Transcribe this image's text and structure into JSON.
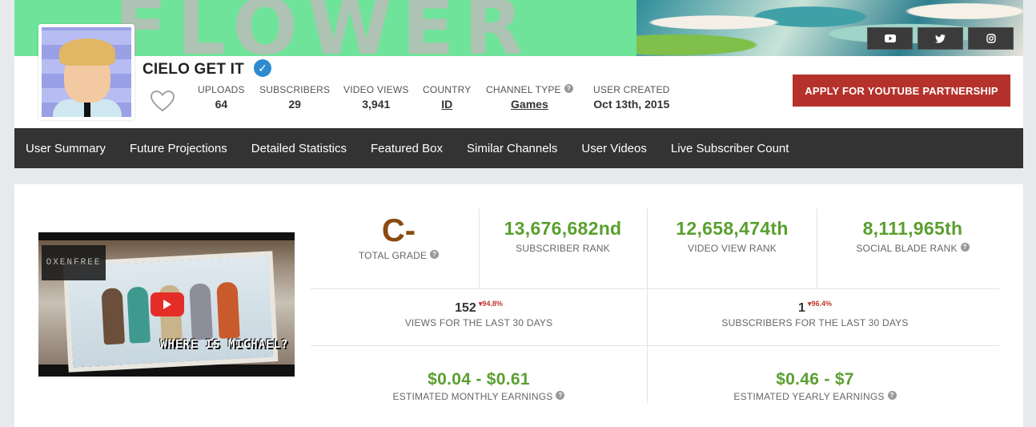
{
  "banner": {
    "watermark_text": "FLOWER"
  },
  "social": {
    "icons": [
      "youtube-icon",
      "twitter-icon",
      "instagram-icon"
    ]
  },
  "channel": {
    "name": "CIELO GET IT",
    "verified": true
  },
  "stats": {
    "uploads": {
      "label": "UPLOADS",
      "value": "64"
    },
    "subscribers": {
      "label": "SUBSCRIBERS",
      "value": "29"
    },
    "video_views": {
      "label": "VIDEO VIEWS",
      "value": "3,941"
    },
    "country": {
      "label": "COUNTRY",
      "value": "ID"
    },
    "channel_type": {
      "label": "CHANNEL TYPE",
      "value": "Games"
    },
    "user_created": {
      "label": "USER CREATED",
      "value": "Oct 13th, 2015"
    }
  },
  "apply_button": "APPLY FOR YOUTUBE PARTNERSHIP",
  "nav": {
    "items": [
      "User Summary",
      "Future Projections",
      "Detailed Statistics",
      "Featured Box",
      "Similar Channels",
      "User Videos",
      "Live Subscriber Count"
    ]
  },
  "video": {
    "overlay_logo": "OXENFREE",
    "caption": "WHERE IS MICHAEL?"
  },
  "ranks": {
    "grade": {
      "value": "C-",
      "label": "TOTAL GRADE"
    },
    "subscriber_rank": {
      "value": "13,676,682nd",
      "label": "SUBSCRIBER RANK"
    },
    "video_view_rank": {
      "value": "12,658,474th",
      "label": "VIDEO VIEW RANK"
    },
    "social_blade_rank": {
      "value": "8,111,965th",
      "label": "SOCIAL BLADE RANK"
    }
  },
  "last30": {
    "views": {
      "value": "152",
      "change": "94.8%",
      "label": "VIEWS FOR THE LAST 30 DAYS"
    },
    "subscribers": {
      "value": "1",
      "change": "96.4%",
      "label": "SUBSCRIBERS FOR THE LAST 30 DAYS"
    }
  },
  "earnings": {
    "monthly": {
      "value": "$0.04 - $0.61",
      "label": "ESTIMATED MONTHLY EARNINGS"
    },
    "yearly": {
      "value": "$0.46 - $7",
      "label": "ESTIMATED YEARLY EARNINGS"
    }
  },
  "colors": {
    "accent_green": "#5a9f2f",
    "grade_brown": "#8a4a12",
    "apply_red": "#b5312b",
    "nav_bg": "#333333",
    "decrease_red": "#c0392b"
  }
}
